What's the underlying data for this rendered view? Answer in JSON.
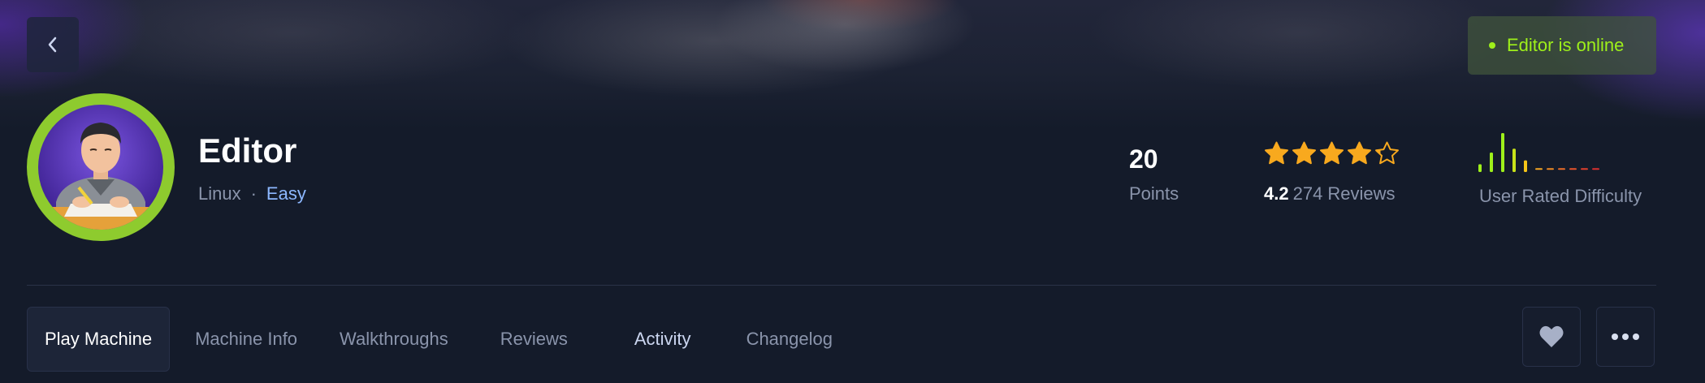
{
  "header": {
    "back_icon": "chevron-left-icon",
    "status_text": "Editor is online",
    "status_color": "#9ef01a"
  },
  "machine": {
    "name": "Editor",
    "os": "Linux",
    "separator": "·",
    "difficulty": "Easy",
    "difficulty_color": "#8db8ff",
    "avatar_ring_color": "#8ecb2e"
  },
  "stats": {
    "points_value": "20",
    "points_label": "Points",
    "rating_value": "4.2",
    "rating_stars": 4.2,
    "reviews_label": "274 Reviews",
    "difficulty_label": "User Rated Difficulty",
    "difficulty_bars": [
      2,
      5,
      10,
      6,
      3,
      1,
      1,
      1,
      1,
      1,
      1
    ]
  },
  "tabs": [
    {
      "label": "Play Machine",
      "active": true
    },
    {
      "label": "Machine Info",
      "active": false
    },
    {
      "label": "Walkthroughs",
      "active": false
    },
    {
      "label": "Reviews",
      "active": false
    },
    {
      "label": "Activity",
      "active": false
    },
    {
      "label": "Changelog",
      "active": false
    }
  ],
  "actions": {
    "favorite_icon": "heart-icon",
    "more_icon": "more-horizontal-icon"
  },
  "colors": {
    "star": "#f8a91e",
    "accent_green": "#9ef01a",
    "muted": "#8a94ab"
  }
}
